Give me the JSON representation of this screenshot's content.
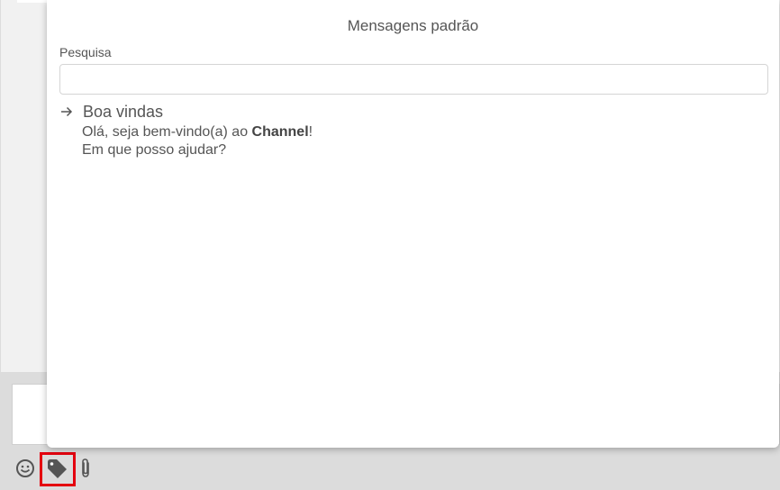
{
  "modal": {
    "title": "Mensagens padrão",
    "search_label": "Pesquisa",
    "search_value": "",
    "search_placeholder": ""
  },
  "messages": [
    {
      "title": "Boa vindas",
      "line1_prefix": "Olá, seja bem-vindo(a) ao ",
      "line1_bold": "Channel",
      "line1_suffix": "!",
      "line2": "Em que posso ajudar?"
    }
  ],
  "toolbar": {
    "icons": [
      "emoji-icon",
      "tag-icon",
      "paperclip-icon"
    ]
  },
  "colors": {
    "text": "#555555",
    "highlight": "#e4000f",
    "icon": "#555555"
  }
}
